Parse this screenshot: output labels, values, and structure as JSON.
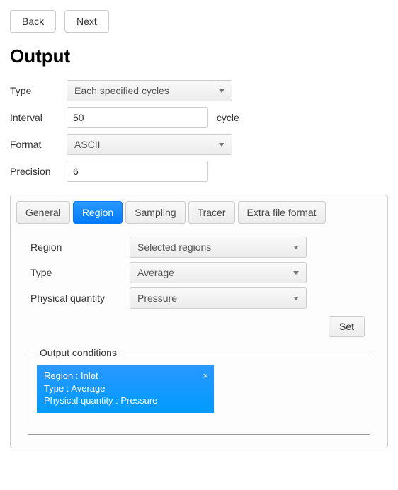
{
  "nav": {
    "back": "Back",
    "next": "Next"
  },
  "title": "Output",
  "form": {
    "type_label": "Type",
    "type_value": "Each specified cycles",
    "interval_label": "Interval",
    "interval_value": "50",
    "interval_unit": "cycle",
    "format_label": "Format",
    "format_value": "ASCII",
    "precision_label": "Precision",
    "precision_value": "6"
  },
  "tabs": {
    "general": "General",
    "region": "Region",
    "sampling": "Sampling",
    "tracer": "Tracer",
    "extra": "Extra file format"
  },
  "region_tab": {
    "region_label": "Region",
    "region_value": "Selected regions",
    "type_label": "Type",
    "type_value": "Average",
    "pq_label": "Physical quantity",
    "pq_value": "Pressure",
    "set_btn": "Set",
    "conditions_legend": "Output conditions",
    "chip_line1": "Region : Inlet",
    "chip_line2": "Type : Average",
    "chip_line3": "Physical quantity : Pressure",
    "chip_close": "×"
  }
}
